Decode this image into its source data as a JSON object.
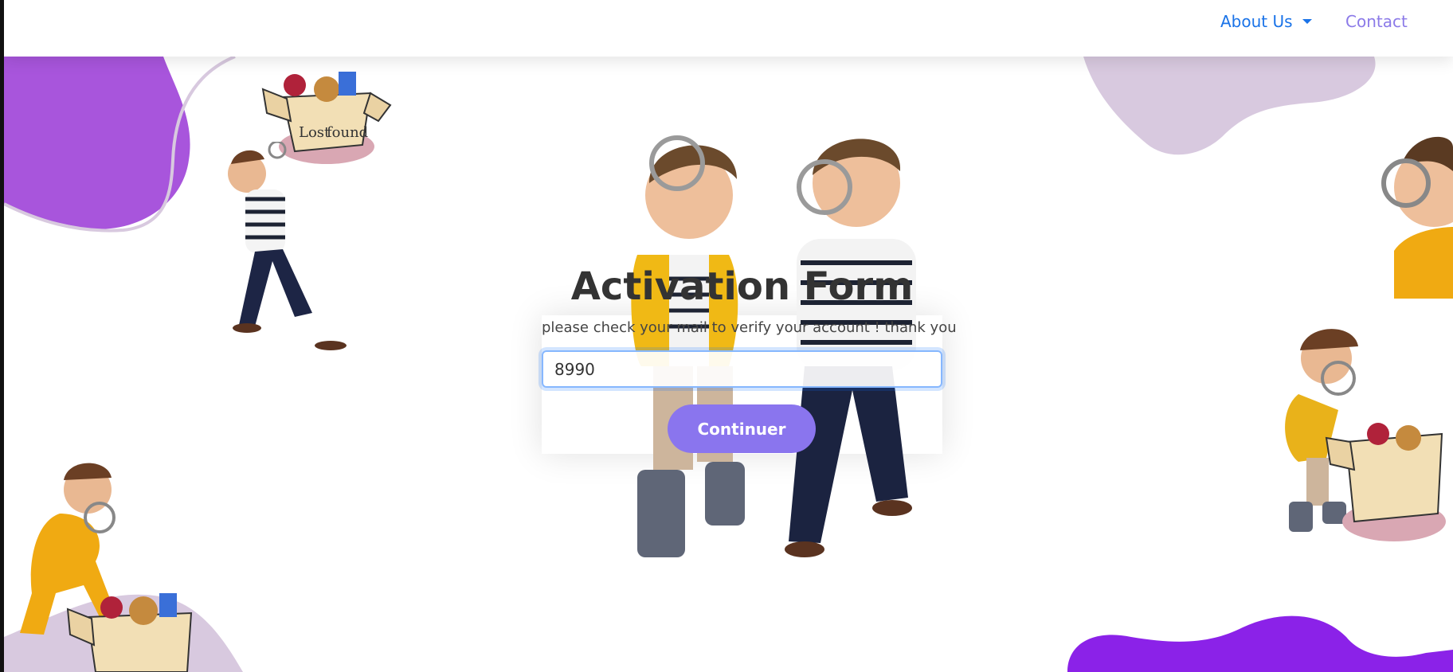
{
  "nav": {
    "about_label": "About Us",
    "contact_label": "Contact"
  },
  "form": {
    "title": "Activation Form",
    "subtitle": "please check your mail to verify your account ! thank you",
    "input_value": "8990",
    "submit_label": "Continuer"
  },
  "decor": {
    "box_label_1": "Lost",
    "box_label_2": "found"
  },
  "colors": {
    "accent": "#8a75ee",
    "nav_link": "#1a73e8",
    "blob_purple": "#a855dc",
    "blob_lilac": "#d8c9df",
    "blob_violet": "#8b22e8"
  }
}
